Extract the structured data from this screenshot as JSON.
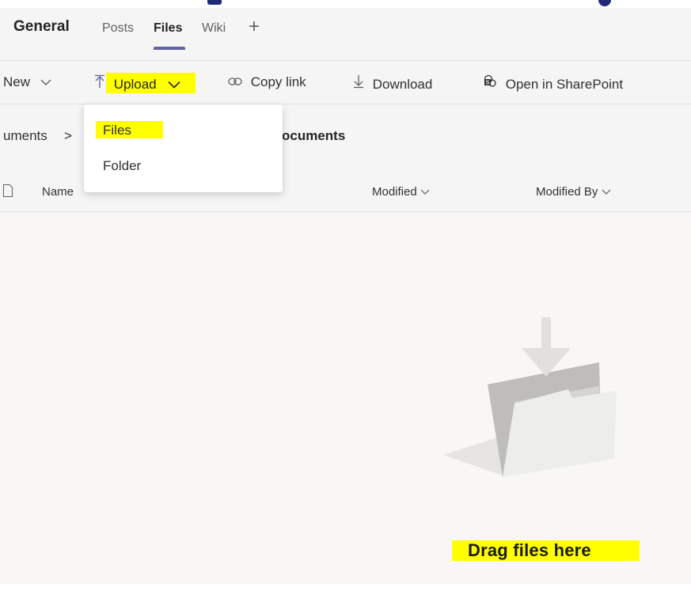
{
  "channel": {
    "name": "General"
  },
  "tabs": [
    {
      "label": "Posts",
      "active": false
    },
    {
      "label": "Files",
      "active": true
    },
    {
      "label": "Wiki",
      "active": false
    }
  ],
  "tab_add_label": "+",
  "toolbar": {
    "new_label": "New",
    "upload_label": "Upload",
    "copy_link_label": "Copy link",
    "download_label": "Download",
    "open_sharepoint_label": "Open in SharePoint"
  },
  "breadcrumb": {
    "parent": "uments",
    "separator": ">",
    "current": "ocuments"
  },
  "columns": {
    "name": "Name",
    "modified": "Modified",
    "modified_by": "Modified By"
  },
  "upload_menu": {
    "items": [
      "Files",
      "Folder"
    ]
  },
  "empty_state": {
    "label": "Drag files here"
  },
  "icons": {
    "upload": "arrow-up-bar-icon",
    "copy_link": "link-icon",
    "download": "arrow-down-bar-icon",
    "sharepoint": "sharepoint-icon",
    "chevron": "chevron-down-icon",
    "file": "file-icon",
    "folder_drop": "folder-drop-icon"
  },
  "colors": {
    "accent": "#6264a7",
    "highlight": "#ffff00"
  }
}
